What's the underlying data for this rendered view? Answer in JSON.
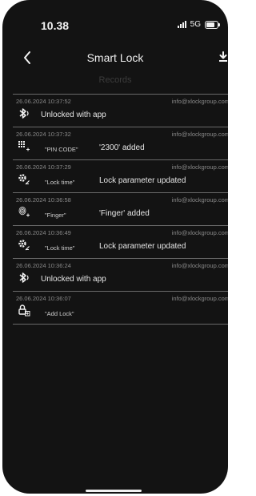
{
  "status_bar": {
    "time": "10.38",
    "network": "5G"
  },
  "header": {
    "back_icon": "chevron-left-icon",
    "title": "Smart Lock",
    "download_icon": "download-icon",
    "subtitle": "Records"
  },
  "records": [
    {
      "date": "26.06.2024 10:37:52",
      "email": "info@xlockgroup.com",
      "icon": "bluetooth-icon",
      "param": "",
      "message": "Unlocked with app"
    },
    {
      "date": "26.06.2024 10:37:32",
      "email": "info@xlockgroup.com",
      "icon": "pin-code-icon",
      "param": "\"PIN CODE\"",
      "message": "'2300' added"
    },
    {
      "date": "26.06.2024 10:37:29",
      "email": "info@xlockgroup.com",
      "icon": "settings-edit-icon",
      "param": "\"Lock time\"",
      "message": "Lock parameter updated"
    },
    {
      "date": "26.06.2024 10:36:58",
      "email": "info@xlockgroup.com",
      "icon": "fingerprint-add-icon",
      "param": "\"Finger\"",
      "message": "'Finger' added"
    },
    {
      "date": "26.06.2024 10:36:49",
      "email": "info@xlockgroup.com",
      "icon": "settings-edit-icon",
      "param": "\"Lock time\"",
      "message": "Lock parameter updated"
    },
    {
      "date": "26.06.2024 10:36:24",
      "email": "info@xlockgroup.com",
      "icon": "bluetooth-icon",
      "param": "",
      "message": "Unlocked with app"
    },
    {
      "date": "26.06.2024 10:36:07",
      "email": "info@xlockgroup.com",
      "icon": "lock-add-icon",
      "param": "\"Add Lock\"",
      "message": ""
    }
  ]
}
